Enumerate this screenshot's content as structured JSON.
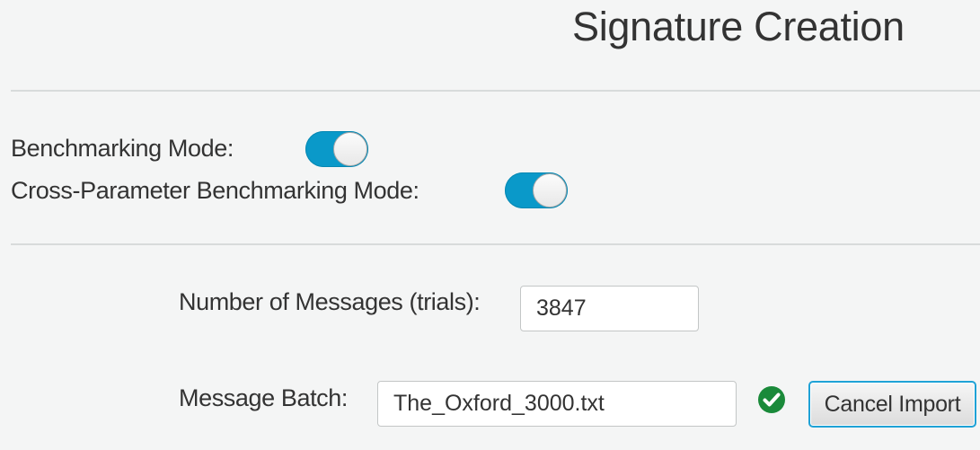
{
  "header": {
    "title": "Signature Creation"
  },
  "benchmarking": {
    "mode_label": "Benchmarking Mode:",
    "mode_enabled": true,
    "cross_param_label": "Cross-Parameter Benchmarking Mode:",
    "cross_param_enabled": true
  },
  "messages": {
    "count_label": "Number of Messages (trials):",
    "count_value": "3847",
    "batch_label": "Message Batch:",
    "batch_value": "The_Oxford_3000.txt",
    "batch_status_icon": "check-circle-icon",
    "cancel_label": "Cancel Import"
  },
  "colors": {
    "toggle_on": "#0a99c9",
    "success": "#1a8a3a",
    "focus": "#1fa2d6"
  }
}
